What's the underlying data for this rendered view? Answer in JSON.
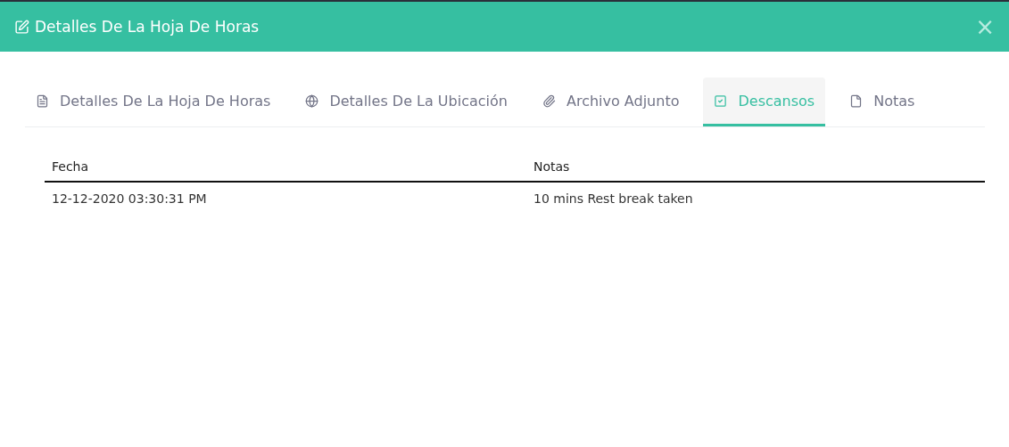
{
  "dialog": {
    "title": "Detalles De La Hoja De Horas",
    "close": "×"
  },
  "tabs": [
    {
      "label": "Detalles De La Hoja De Horas",
      "selected": false
    },
    {
      "label": "Detalles De La Ubicación",
      "selected": false
    },
    {
      "label": "Archivo Adjunto",
      "selected": false
    },
    {
      "label": "Descansos",
      "selected": true
    },
    {
      "label": "Notas",
      "selected": false
    }
  ],
  "table": {
    "columns": [
      "Fecha",
      "Notas"
    ],
    "rows": [
      [
        "12-12-2020 03:30:31 PM",
        "10 mins Rest break taken"
      ]
    ]
  }
}
